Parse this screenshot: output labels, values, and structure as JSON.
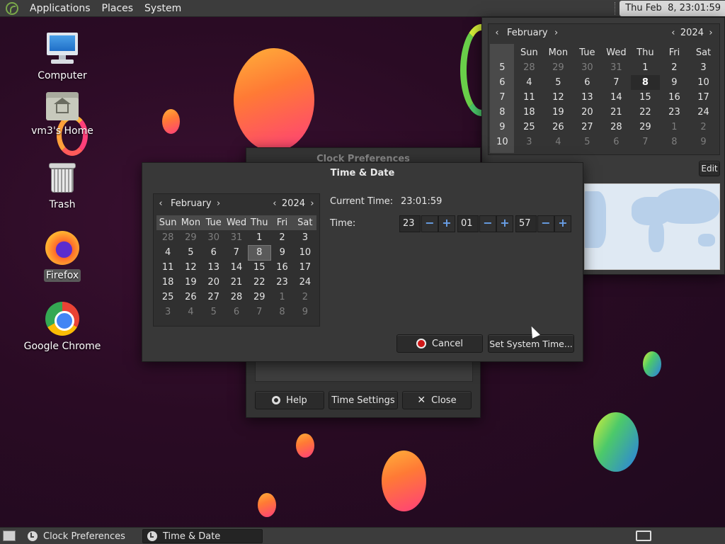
{
  "top_panel": {
    "menus": [
      "Applications",
      "Places",
      "System"
    ],
    "clock": "Thu Feb  8, 23:01:59"
  },
  "desktop_icons": [
    {
      "label": "Computer",
      "icon": "computer-icon"
    },
    {
      "label": "vm3's Home",
      "icon": "home-folder-icon"
    },
    {
      "label": "Trash",
      "icon": "trash-icon"
    },
    {
      "label": "Firefox",
      "icon": "firefox-icon",
      "selected": true
    },
    {
      "label": "Google Chrome",
      "icon": "chrome-icon"
    }
  ],
  "clock_popup": {
    "month": "February",
    "year": "2024",
    "day_headers": [
      "Sun",
      "Mon",
      "Tue",
      "Wed",
      "Thu",
      "Fri",
      "Sat"
    ],
    "week_numbers": [
      "5",
      "6",
      "7",
      "8",
      "9",
      "10"
    ],
    "weeks": [
      [
        "28",
        "29",
        "30",
        "31",
        "1",
        "2",
        "3"
      ],
      [
        "4",
        "5",
        "6",
        "7",
        "8",
        "9",
        "10"
      ],
      [
        "11",
        "12",
        "13",
        "14",
        "15",
        "16",
        "17"
      ],
      [
        "18",
        "19",
        "20",
        "21",
        "22",
        "23",
        "24"
      ],
      [
        "25",
        "26",
        "27",
        "28",
        "29",
        "1",
        "2"
      ],
      [
        "3",
        "4",
        "5",
        "6",
        "7",
        "8",
        "9"
      ]
    ],
    "today": "8",
    "edit_label": "Edit"
  },
  "clock_prefs": {
    "title": "Clock Preferences",
    "help_label": "Help",
    "time_settings_label": "Time Settings",
    "close_label": "Close"
  },
  "time_date": {
    "title": "Time & Date",
    "month": "February",
    "year": "2024",
    "day_headers": [
      "Sun",
      "Mon",
      "Tue",
      "Wed",
      "Thu",
      "Fri",
      "Sat"
    ],
    "weeks": [
      [
        "28",
        "29",
        "30",
        "31",
        "1",
        "2",
        "3"
      ],
      [
        "4",
        "5",
        "6",
        "7",
        "8",
        "9",
        "10"
      ],
      [
        "11",
        "12",
        "13",
        "14",
        "15",
        "16",
        "17"
      ],
      [
        "18",
        "19",
        "20",
        "21",
        "22",
        "23",
        "24"
      ],
      [
        "25",
        "26",
        "27",
        "28",
        "29",
        "1",
        "2"
      ],
      [
        "3",
        "4",
        "5",
        "6",
        "7",
        "8",
        "9"
      ]
    ],
    "selected_day": "8",
    "current_time_label": "Current Time:",
    "current_time_value": "23:01:59",
    "time_label": "Time:",
    "hours": "23",
    "minutes": "01",
    "seconds": "57",
    "minus_glyph": "−",
    "plus_glyph": "+",
    "cancel_label": "Cancel",
    "set_label": "Set System Time..."
  },
  "taskbar": {
    "tasks": [
      "Clock Preferences",
      "Time & Date"
    ]
  },
  "colors": {
    "panel": "#3c3c3c",
    "window_bg": "#363636",
    "accent_spin": "#6aa0e8",
    "cancel_red": "#d01818"
  }
}
